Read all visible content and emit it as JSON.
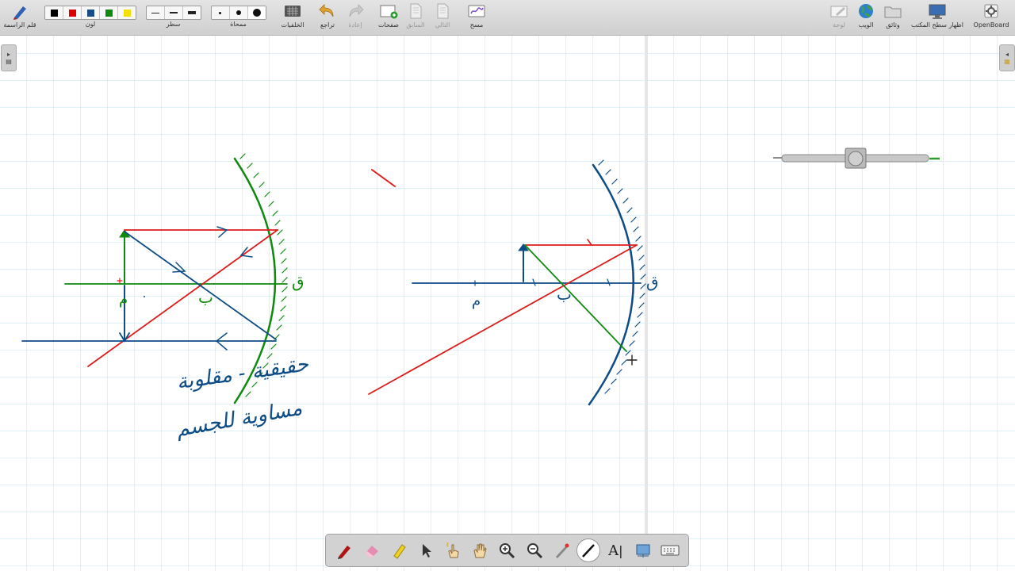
{
  "toolbar": {
    "pen": "قلم الراسمة",
    "color": "لون",
    "line": "سطر",
    "eraser": "ممحاة",
    "backgrounds": "الخلفيات",
    "undo": "تراجع",
    "redo": "إعادة",
    "pages": "صفحات",
    "previous": "السابق",
    "next": "التالي",
    "clear": "مسح",
    "board": "لوحة",
    "web": "الويب",
    "documents": "وثائق",
    "desktop": "اظهار سطح المكتب",
    "app": "OpenBoard",
    "colors": [
      "#000000",
      "#dd0000",
      "#1a4c8c",
      "#118811",
      "#f2e000"
    ]
  },
  "board": {
    "left_labels": {
      "center": "م",
      "focus": "ب",
      "pole": "ق"
    },
    "right_labels": {
      "center": "م",
      "focus": "ب",
      "pole": "ق"
    },
    "handwriting_line1": "حقيقية - مقلوبة",
    "handwriting_line2": "مساوية للجسم",
    "ink_colors": {
      "red": "#dd1c1c",
      "green": "#0f8a0f",
      "blue": "#0e4c86"
    }
  },
  "dock": {
    "tools": [
      "pen-tool",
      "eraser-tool",
      "marker-tool",
      "selector-tool",
      "interact-tool",
      "hand-tool",
      "zoom-in-tool",
      "zoom-out-tool",
      "laser-tool",
      "line-tool",
      "text-tool",
      "capture-tool",
      "keyboard-tool"
    ],
    "text_tool_label": "A"
  }
}
